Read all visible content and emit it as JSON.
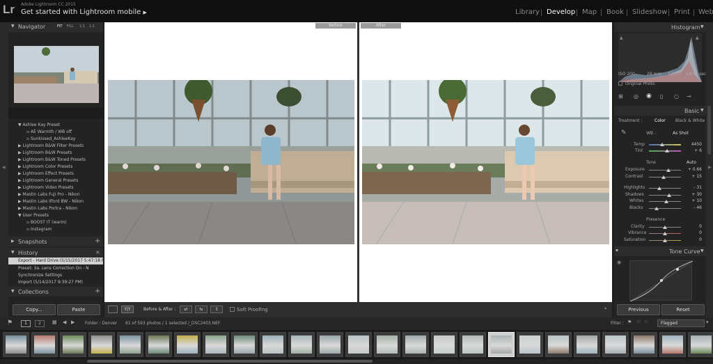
{
  "app": {
    "subtitle": "Adobe Lightroom CC 2015",
    "catalog": "Get started with Lightroom mobile",
    "logo": "Lr"
  },
  "modules": [
    "Library",
    "Develop",
    "Map",
    "Book",
    "Slideshow",
    "Print",
    "Web"
  ],
  "active_module": "Develop",
  "left": {
    "navigator": "Navigator",
    "nav_zoom": [
      "FIT",
      "FILL",
      "1:1",
      "1:1"
    ],
    "presets": [
      "Ashlee Kay  Preset",
      "AE Warmth / WB off",
      "Sunkissed_AshleeKay",
      "Lightroom B&W Filter Presets",
      "Lightroom B&W Presets",
      "Lightroom B&W Toned Presets",
      "Lightroom Color Presets",
      "Lightroom Effect Presets",
      "Lightroom General Presets",
      "Lightroom Video Presets",
      "Mastin Labs Fuji Pro - Nikon",
      "Mastin Labs Ilford BW - Nikon",
      "Mastin Labs Portra - Nikon",
      "User Presets",
      "BOOST IT (warm)",
      "Instagram"
    ],
    "snapshots": "Snapshots",
    "history": "History",
    "history_items": [
      "Export - Hard Drive (5/15/2017 5:47:18 P...",
      "Preset: 3a. Lens Correction On - N",
      "Synchronize Settings",
      "Import (5/14/2017 9:39:27 PM)"
    ],
    "collections": "Collections",
    "copy": "Copy...",
    "paste": "Paste"
  },
  "center": {
    "before": "Before",
    "after": "After"
  },
  "toolbar": {
    "yy": "Y|Y",
    "before_after": "Before & After :",
    "soft_proofing": "Soft Proofing"
  },
  "right": {
    "histogram": "Histogram",
    "exif": [
      "ISO 200",
      "28 mm",
      "f / 3.5",
      "1/640 sec"
    ],
    "original_photo": "Original Photo",
    "basic": "Basic",
    "treatment": "Treatment :",
    "color": "Color",
    "bw": "Black & White",
    "wb": "WB :",
    "wb_value": "As Shot",
    "temp": {
      "label": "Temp",
      "value": "4450"
    },
    "tint": {
      "label": "Tint",
      "value": "+ 6"
    },
    "tone": "Tone",
    "auto": "Auto",
    "sliders": [
      {
        "label": "Exposure",
        "value": "+ 0.66"
      },
      {
        "label": "Contrast",
        "value": "+ 15"
      },
      {
        "label": "Highlights",
        "value": "- 31"
      },
      {
        "label": "Shadows",
        "value": "+ 30"
      },
      {
        "label": "Whites",
        "value": "+ 10"
      },
      {
        "label": "Blacks",
        "value": "- 46"
      }
    ],
    "presence": "Presence",
    "presence_sliders": [
      {
        "label": "Clarity",
        "value": "0"
      },
      {
        "label": "Vibrance",
        "value": "0"
      },
      {
        "label": "Saturation",
        "value": "0"
      }
    ],
    "tone_curve": "Tone Curve",
    "previous": "Previous",
    "reset": "Reset"
  },
  "filmbar": {
    "page1": "1",
    "page2": "2",
    "folder": "Folder : Denver",
    "info": "61 of 593 photos / 1 selected /_DSC2403.NEF",
    "filter": "Filter :",
    "flagged": "Flagged"
  },
  "colors": {
    "accent": "#ffffff",
    "panel": "#232323",
    "background": "#1e1e1e"
  }
}
